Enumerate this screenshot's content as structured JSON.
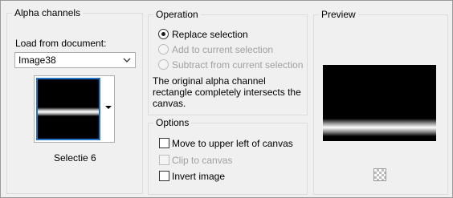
{
  "alpha_channels": {
    "title": "Alpha channels",
    "load_from_label": "Load from document:",
    "document_value": "Image38",
    "selected_channel": "Selectie 6"
  },
  "operation": {
    "title": "Operation",
    "options": [
      {
        "label": "Replace selection",
        "selected": true,
        "enabled": true
      },
      {
        "label": "Add to current selection",
        "selected": false,
        "enabled": false
      },
      {
        "label": "Subtract from current selection",
        "selected": false,
        "enabled": false
      }
    ],
    "description": "The original alpha channel rectangle completely intersects the canvas."
  },
  "options_group": {
    "title": "Options",
    "items": [
      {
        "label": "Move to upper left of canvas",
        "checked": false,
        "enabled": true
      },
      {
        "label": "Clip to canvas",
        "checked": false,
        "enabled": false
      },
      {
        "label": "Invert image",
        "checked": false,
        "enabled": true
      }
    ]
  },
  "preview": {
    "title": "Preview",
    "icon": "checkerboard-icon"
  },
  "colors": {
    "thumbnail_border": "#1f73c9",
    "background": "#f0f0f0"
  }
}
